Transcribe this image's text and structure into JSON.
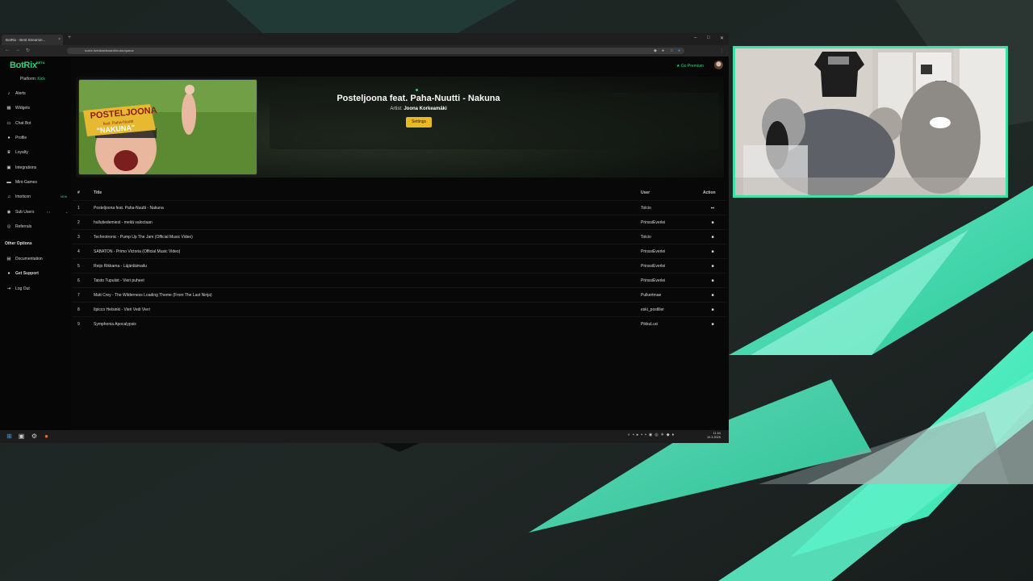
{
  "browser": {
    "tab_title": "BotRix - Best Streamin...",
    "tab_close": "×",
    "new_tab": "+",
    "url": "botrix.live/dashboard/music/queue"
  },
  "sidebar": {
    "brand": "BotRix",
    "beta": "BETA",
    "platform_label": "Platform:",
    "platform_value": "Kick",
    "items": [
      {
        "label": "Alerts",
        "icon": "bell-icon"
      },
      {
        "label": "Widgets",
        "icon": "widget-icon"
      },
      {
        "label": "Chat Bot",
        "icon": "chat-icon"
      },
      {
        "label": "Profile",
        "icon": "user-icon"
      },
      {
        "label": "Loyalty",
        "icon": "trophy-icon"
      },
      {
        "label": "Integrations",
        "icon": "plug-icon"
      },
      {
        "label": "Mini-Games",
        "icon": "gamepad-icon"
      },
      {
        "label": "Imoticon",
        "icon": "music-icon",
        "badge": "NEW"
      },
      {
        "label": "Sub Users",
        "icon": "users-icon"
      },
      {
        "label": "Referrals",
        "icon": "people-icon"
      }
    ],
    "other_title": "Other Options",
    "other_items": [
      {
        "label": "Documentation",
        "icon": "doc-icon"
      },
      {
        "label": "Get Support",
        "icon": "support-icon"
      },
      {
        "label": "Log Out",
        "icon": "logout-icon"
      }
    ]
  },
  "topbar": {
    "premium": "Go Premium"
  },
  "now_playing": {
    "title": "Posteljoona feat. Paha-Nuutti - Nakuna",
    "artist_label": "Artist:",
    "artist": "Joona Korkeamäki",
    "settings_button": "Settings",
    "thumb_line1": "POSTELJOONA",
    "thumb_line2": "feat. Paha-Nuutti",
    "thumb_line3": "\"NAKUNA\""
  },
  "queue": {
    "headers": {
      "num": "#",
      "title": "Title",
      "user": "User",
      "action": "Action"
    },
    "rows": [
      {
        "num": "1",
        "title": "Posteljoona feat. Paha-Nuutti - Nakuna",
        "user": "Tolcio",
        "action": "skip"
      },
      {
        "num": "2",
        "title": "hullutiedemiest - meitä valoctaan",
        "user": "PrinssiEverlei",
        "action": "delete"
      },
      {
        "num": "3",
        "title": "Technotronic - Pump Up The Jam (Official Music Video)",
        "user": "Tolcio",
        "action": "delete"
      },
      {
        "num": "4",
        "title": "SABATON - Primo Victoria (Official Music Video)",
        "user": "PrinssiEverlei",
        "action": "delete"
      },
      {
        "num": "5",
        "title": "Reijo Rikkama - Läjänläimailu",
        "user": "PrinssiEverlei",
        "action": "delete"
      },
      {
        "num": "6",
        "title": "Taisto Tupulist - Vieri puheet",
        "user": "PrinssiEverlei",
        "action": "delete"
      },
      {
        "num": "7",
        "title": "Matt Crey - The Wilderness Loading Theme (From The Last Ninja)",
        "user": "Pulkertmae",
        "action": "delete"
      },
      {
        "num": "8",
        "title": "Ilpicco Helsinki - Vieri Vedi Vieri",
        "user": "eski_postliler",
        "action": "delete"
      },
      {
        "num": "9",
        "title": "Symphonia Apocalypsis",
        "user": "PikkuLuci",
        "action": "delete"
      }
    ]
  },
  "taskbar": {
    "clock_time": "11.54",
    "clock_date": "10.3.2025"
  },
  "colors": {
    "accent": "#33d17a",
    "settings_button": "#e8b923",
    "cam_border": "#3de0a9"
  }
}
